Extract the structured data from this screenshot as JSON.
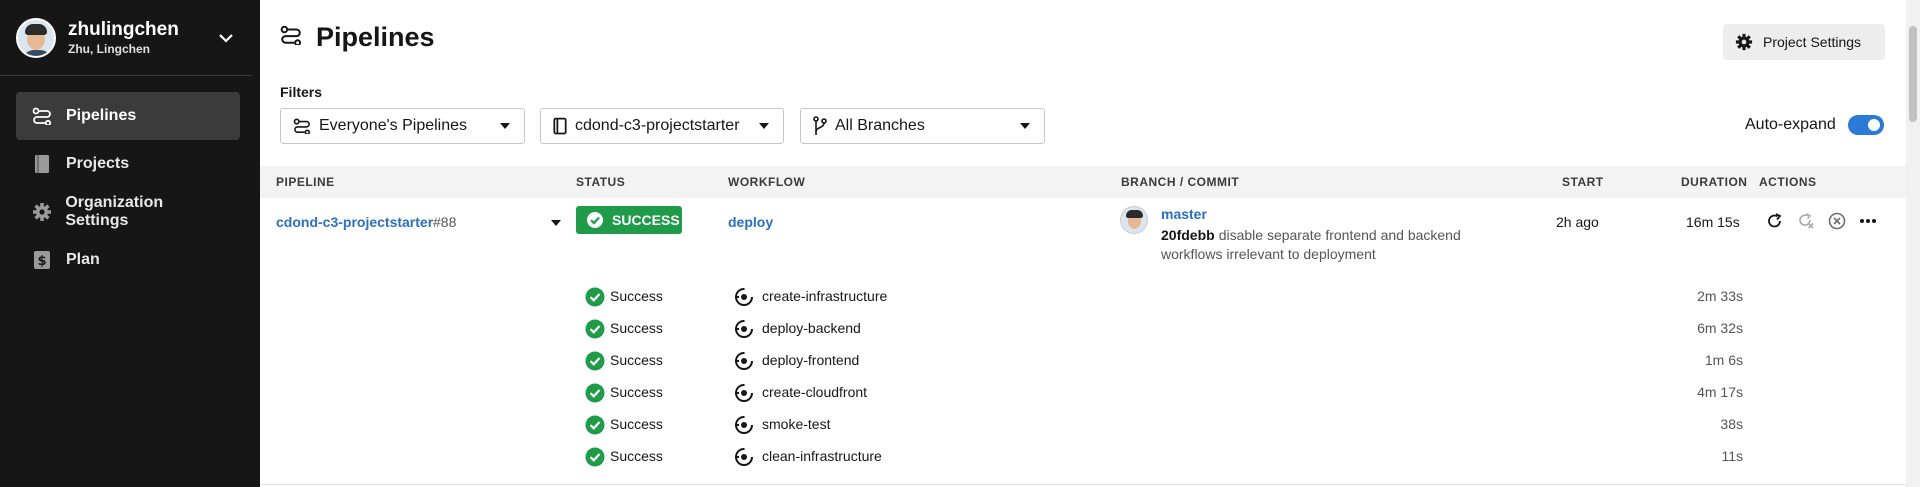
{
  "user": {
    "username": "zhulingchen",
    "full_name": "Zhu, Lingchen"
  },
  "sidebar": {
    "items": [
      {
        "label": "Pipelines",
        "icon": "pipelines-icon",
        "active": true
      },
      {
        "label": "Projects",
        "icon": "book-icon",
        "active": false
      },
      {
        "label": "Organization Settings",
        "icon": "gear-icon",
        "active": false
      },
      {
        "label": "Plan",
        "icon": "dollar-icon",
        "active": false
      }
    ]
  },
  "header": {
    "title": "Pipelines",
    "project_settings": "Project Settings"
  },
  "filters": {
    "label": "Filters",
    "pipelines": "Everyone's Pipelines",
    "project": "cdond-c3-projectstarter",
    "branches": "All Branches"
  },
  "auto_expand": {
    "label": "Auto-expand",
    "enabled": true
  },
  "table": {
    "headers": {
      "pipeline": "PIPELINE",
      "status": "STATUS",
      "workflow": "WORKFLOW",
      "branch_commit": "BRANCH / COMMIT",
      "start": "START",
      "duration": "DURATION",
      "actions": "ACTIONS"
    },
    "pipeline": {
      "name": "cdond-c3-projectstarter",
      "number": "#88",
      "status": "SUCCESS",
      "workflow": "deploy",
      "branch": "master",
      "commit_hash": "20fdebb",
      "commit_message": "disable separate frontend and backend workflows irrelevant to deployment",
      "start": "2h ago",
      "duration": "16m 15s"
    },
    "jobs": [
      {
        "status": "Success",
        "name": "create-infrastructure",
        "duration": "2m 33s"
      },
      {
        "status": "Success",
        "name": "deploy-backend",
        "duration": "6m 32s"
      },
      {
        "status": "Success",
        "name": "deploy-frontend",
        "duration": "1m 6s"
      },
      {
        "status": "Success",
        "name": "create-cloudfront",
        "duration": "4m 17s"
      },
      {
        "status": "Success",
        "name": "smoke-test",
        "duration": "38s"
      },
      {
        "status": "Success",
        "name": "clean-infrastructure",
        "duration": "11s"
      }
    ]
  },
  "colors": {
    "sidebar_bg": "#161616",
    "success": "#1f9b4a",
    "link": "#2a6fc0",
    "toggle": "#2a7bd5"
  }
}
